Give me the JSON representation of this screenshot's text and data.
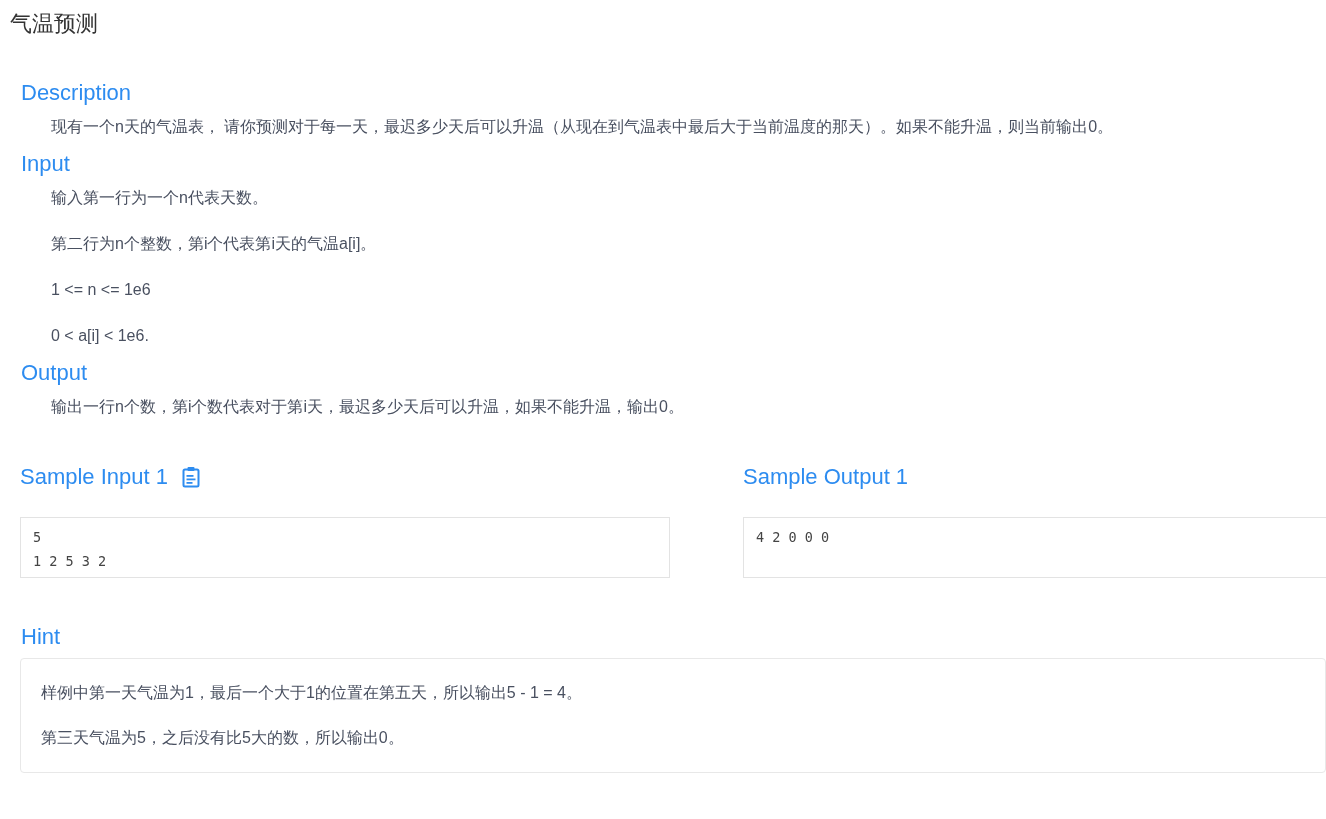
{
  "title": "气温预测",
  "sections": [
    {
      "heading": "Description",
      "paragraphs": [
        "现有一个n天的气温表， 请你预测对于每一天，最迟多少天后可以升温（从现在到气温表中最后大于当前温度的那天）。如果不能升温，则当前输出0。"
      ]
    },
    {
      "heading": "Input",
      "paragraphs": [
        "输入第一行为一个n代表天数。",
        "第二行为n个整数，第i个代表第i天的气温a[i]。",
        "1 <= n <= 1e6",
        "0 < a[i] < 1e6."
      ]
    },
    {
      "heading": "Output",
      "paragraphs": [
        "输出一行n个数，第i个数代表对于第i天，最迟多少天后可以升温，如果不能升温，输出0。"
      ]
    }
  ],
  "samples": [
    {
      "kind": "input",
      "heading": "Sample Input 1",
      "content": "5\n1 2 5 3 2"
    },
    {
      "kind": "output",
      "heading": "Sample Output 1",
      "content": "4 2 0 0 0"
    }
  ],
  "hint": {
    "heading": "Hint",
    "paragraphs": [
      "样例中第一天气温为1，最后一个大于1的位置在第五天，所以输出5 - 1 = 4。",
      "第三天气温为5，之后没有比5大的数，所以输出0。"
    ]
  }
}
